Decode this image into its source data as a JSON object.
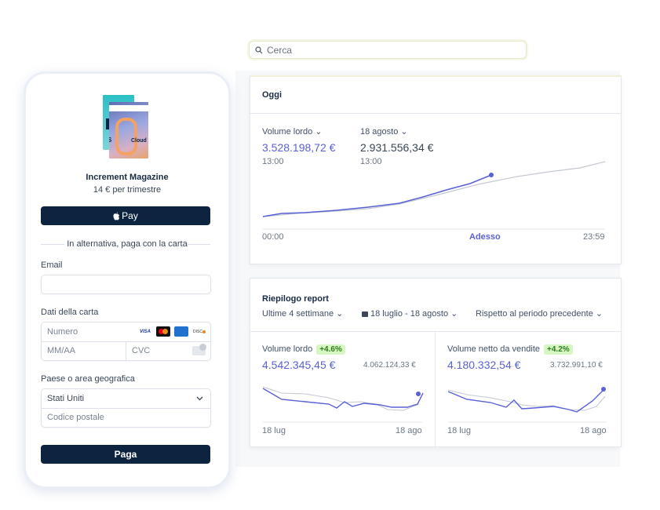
{
  "search": {
    "placeholder": "Cerca"
  },
  "today": {
    "title": "Oggi",
    "metric1": {
      "label": "Volume lordo",
      "value": "3.528.198,72 €",
      "time": "13:00"
    },
    "metric2": {
      "label": "18 agosto",
      "value": "2.931.556,34 €",
      "time": "13:00"
    },
    "axis": {
      "start": "00:00",
      "now": "Adesso",
      "end": "23:59"
    }
  },
  "report": {
    "title": "Riepilogo report",
    "filters": {
      "period": "Ultime 4 settimane",
      "range": "18 luglio - 18 agosto",
      "compare": "Rispetto al periodo precedente"
    },
    "panel1": {
      "label": "Volume lordo",
      "badge": "+4.6%",
      "value": "4.542.345,45 €",
      "prev": "4.062.124,33 €",
      "x_start": "18 lug",
      "x_end": "18 ago"
    },
    "panel2": {
      "label": "Volume netto da vendite",
      "badge": "+4.2%",
      "value": "4.180.332,54 €",
      "prev": "3.732.991,10 €",
      "x_start": "18 lug",
      "x_end": "18 ago"
    }
  },
  "checkout": {
    "product_name": "Increment Magazine",
    "price": "14 € per trimestre",
    "applepay_label": "Pay",
    "divider_text": "In alternativa, paga con la carta",
    "email_label": "Email",
    "card_label": "Dati della carta",
    "number_placeholder": "Numero",
    "expiry_placeholder": "MM/AA",
    "cvc_placeholder": "CVC",
    "card_brands": [
      "VISA",
      "mastercard",
      "amex",
      "discover"
    ],
    "country_label": "Paese o area geografica",
    "country_value": "Stati Uniti",
    "zip_placeholder": "Codice postale",
    "pay_button": "Paga",
    "cover_words": [
      "S",
      "Cloud"
    ]
  },
  "colors": {
    "accent": "#5a61d6",
    "navy": "#0d2440",
    "badge_bg": "#d7f7c2",
    "compare_line": "#c4c9d1"
  }
}
